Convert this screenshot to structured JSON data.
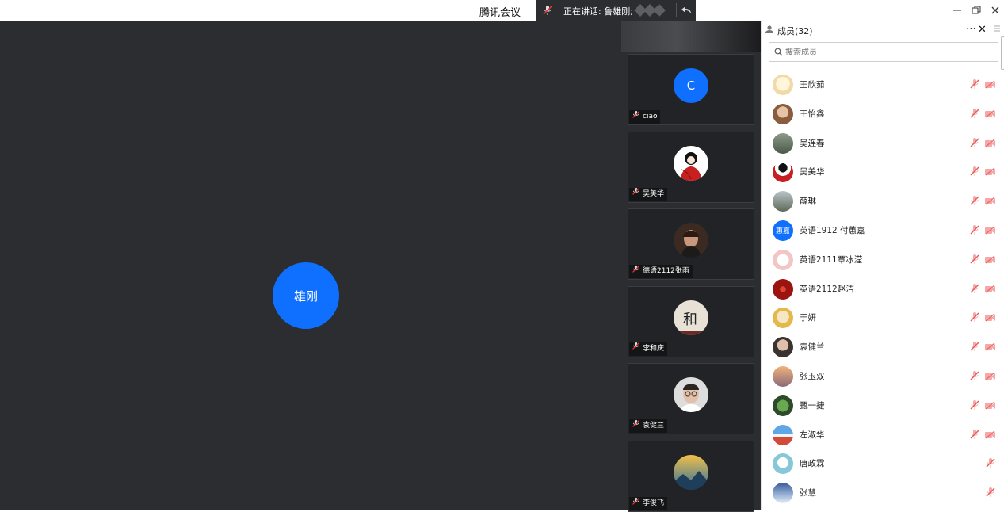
{
  "app": {
    "title": "腾讯会议"
  },
  "speaking": {
    "text": "正在讲话: 鲁雄刚;"
  },
  "main": {
    "speaker_name": "雄刚",
    "speaker_color": "#0f6fff"
  },
  "video_tiles": [
    {
      "name": "ciao",
      "avatar": "letter",
      "letter": "C",
      "color": "#0f6fff"
    },
    {
      "name": "吴美华",
      "avatar": "cartoon"
    },
    {
      "name": "德语2112张雨",
      "avatar": "portrait"
    },
    {
      "name": "李和庆",
      "avatar": "calligraphy"
    },
    {
      "name": "袁健兰",
      "avatar": "glasses"
    },
    {
      "name": "李俊飞",
      "avatar": "landscape"
    }
  ],
  "panel": {
    "title": "成员(32)",
    "search_placeholder": "搜索成员",
    "members": [
      {
        "name": "王欣茹",
        "avatar": "cartoon-cream",
        "camera": true
      },
      {
        "name": "王怡鑫",
        "avatar": "photo-warm",
        "camera": true
      },
      {
        "name": "吴连春",
        "avatar": "photo-green",
        "camera": true
      },
      {
        "name": "吴美华",
        "avatar": "cartoon-red",
        "camera": true
      },
      {
        "name": "薛琳",
        "avatar": "photo-street",
        "camera": true
      },
      {
        "name": "英语1912 付蕙嘉",
        "avatar": "text",
        "avatar_text": "蕙嘉",
        "camera": true
      },
      {
        "name": "英语2111覃冰滢",
        "avatar": "cartoon-pink",
        "camera": true
      },
      {
        "name": "英语2112赵洁",
        "avatar": "red-pattern",
        "camera": true
      },
      {
        "name": "于妍",
        "avatar": "photo-yellow",
        "camera": true
      },
      {
        "name": "袁健兰",
        "avatar": "photo-person",
        "camera": true
      },
      {
        "name": "张玉双",
        "avatar": "sunset",
        "camera": true
      },
      {
        "name": "甄一捷",
        "avatar": "nature",
        "camera": true
      },
      {
        "name": "左淑华",
        "avatar": "beach",
        "camera": true
      },
      {
        "name": "唐政霖",
        "avatar": "alpaca",
        "camera": false
      },
      {
        "name": "张慧",
        "avatar": "sky",
        "camera": false
      }
    ]
  }
}
